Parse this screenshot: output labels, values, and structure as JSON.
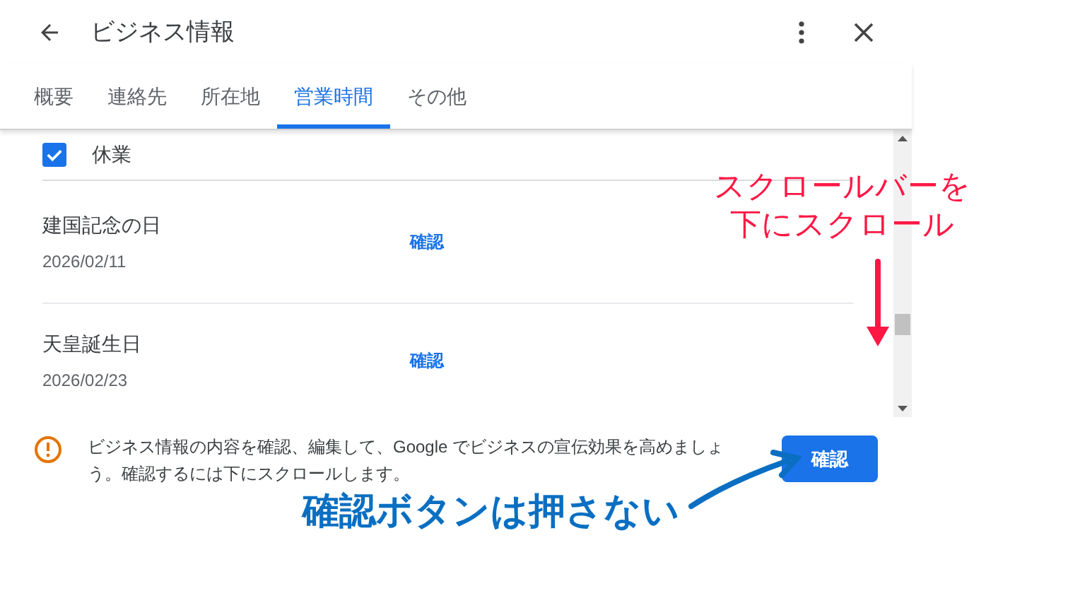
{
  "header": {
    "title": "ビジネス情報"
  },
  "tabs": [
    {
      "label": "概要",
      "selected": false
    },
    {
      "label": "連絡先",
      "selected": false
    },
    {
      "label": "所在地",
      "selected": false
    },
    {
      "label": "営業時間",
      "selected": true
    },
    {
      "label": "その他",
      "selected": false
    }
  ],
  "closed_option": {
    "label": "休業",
    "checked": true
  },
  "holidays": [
    {
      "name": "建国記念の日",
      "date": "2026/02/11",
      "action": "確認"
    },
    {
      "name": "天皇誕生日",
      "date": "2026/02/23",
      "action": "確認"
    }
  ],
  "notice": {
    "text": "ビジネス情報の内容を確認、編集して、Google でビジネスの宣伝効果を高めましょう。確認するには下にスクロールします。",
    "button": "確認"
  },
  "annotations": [
    {
      "kind": "down",
      "color": "#ff1744",
      "lines": [
        "スクロールバーを",
        "下にスクロール"
      ]
    },
    {
      "kind": "pointer",
      "color": "#0a6fc2",
      "lines": [
        "確認ボタンは押さない"
      ]
    }
  ]
}
